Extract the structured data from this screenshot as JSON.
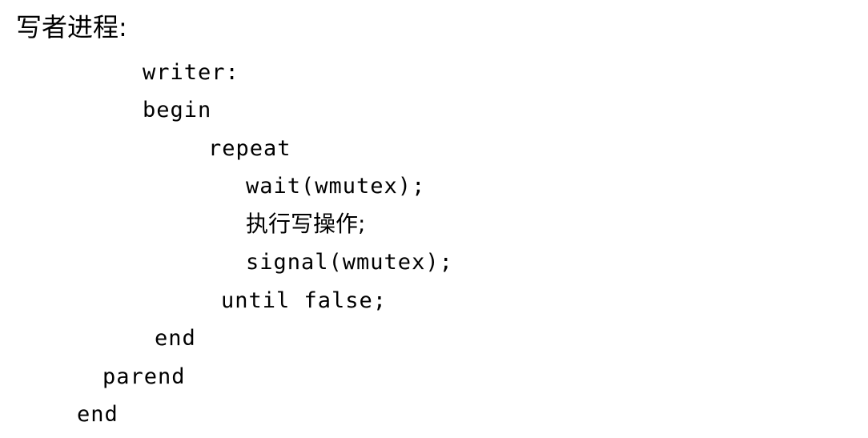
{
  "document": {
    "heading": "写者进程:",
    "lines": [
      "writer:",
      "begin",
      "repeat",
      "wait(wmutex);",
      "执行写操作;",
      "signal(wmutex);",
      "until false;",
      "end",
      "parend",
      "end"
    ]
  }
}
